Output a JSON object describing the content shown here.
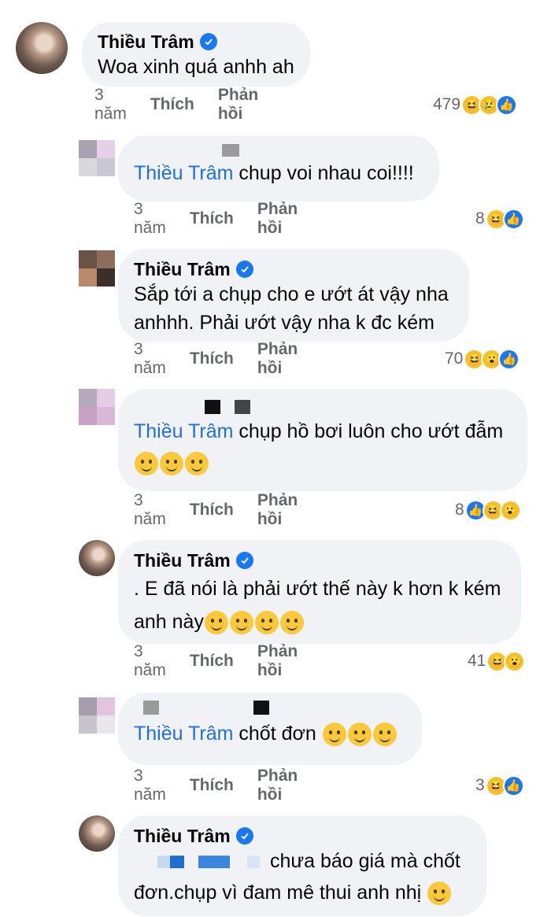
{
  "comments": [
    {
      "name": "Thiều Trâm",
      "text": "Woa xinh quá anhh ah",
      "time": "3 năm",
      "like": "Thích",
      "reply": "Phản hồi",
      "count": "479"
    },
    {
      "mention": "Thiều Trâm",
      "text": " chup voi nhau coi!!!!",
      "time": "3 năm",
      "like": "Thích",
      "reply": "Phản hồi",
      "count": "8"
    },
    {
      "name": "Thiều Trâm",
      "line1": "Sắp tới a chụp cho e ướt át vậy nha",
      "line2": "anhhh. Phải ướt vậy nha k đc kém",
      "time": "3 năm",
      "like": "Thích",
      "reply": "Phản hồi",
      "count": "70"
    },
    {
      "mention": "Thiều Trâm",
      "text": " chụp hồ bơi luôn cho ướt đẫm",
      "time": "3 năm",
      "like": "Thích",
      "reply": "Phản hồi",
      "count": "8"
    },
    {
      "name": "Thiều Trâm",
      "line1": ". E đã nói là phải ướt thế này k hơn k kém",
      "line2": "anh này",
      "time": "3 năm",
      "like": "Thích",
      "reply": "Phản hồi",
      "count": "41"
    },
    {
      "mention": "Thiều Trâm",
      "text": " chốt đơn",
      "time": "3 năm",
      "like": "Thích",
      "reply": "Phản hồi",
      "count": "3"
    },
    {
      "name": "Thiều Trâm",
      "line1": "chưa báo giá mà chốt",
      "line2": "đơn.chụp  vì đam mê thui anh nhị"
    }
  ],
  "colors": {
    "accent": "#1877f2",
    "mention": "#216fdb",
    "bubble": "#f0f2f5",
    "meta": "#65676b"
  },
  "icons": {
    "verified": "verified-badge-icon",
    "haha": "haha-reaction-icon",
    "wow": "wow-reaction-icon",
    "sad": "sad-reaction-icon",
    "like": "like-reaction-icon",
    "kiss": "kiss-emoji-icon",
    "rofl": "rofl-emoji-icon",
    "smile": "smile-emoji-icon"
  }
}
